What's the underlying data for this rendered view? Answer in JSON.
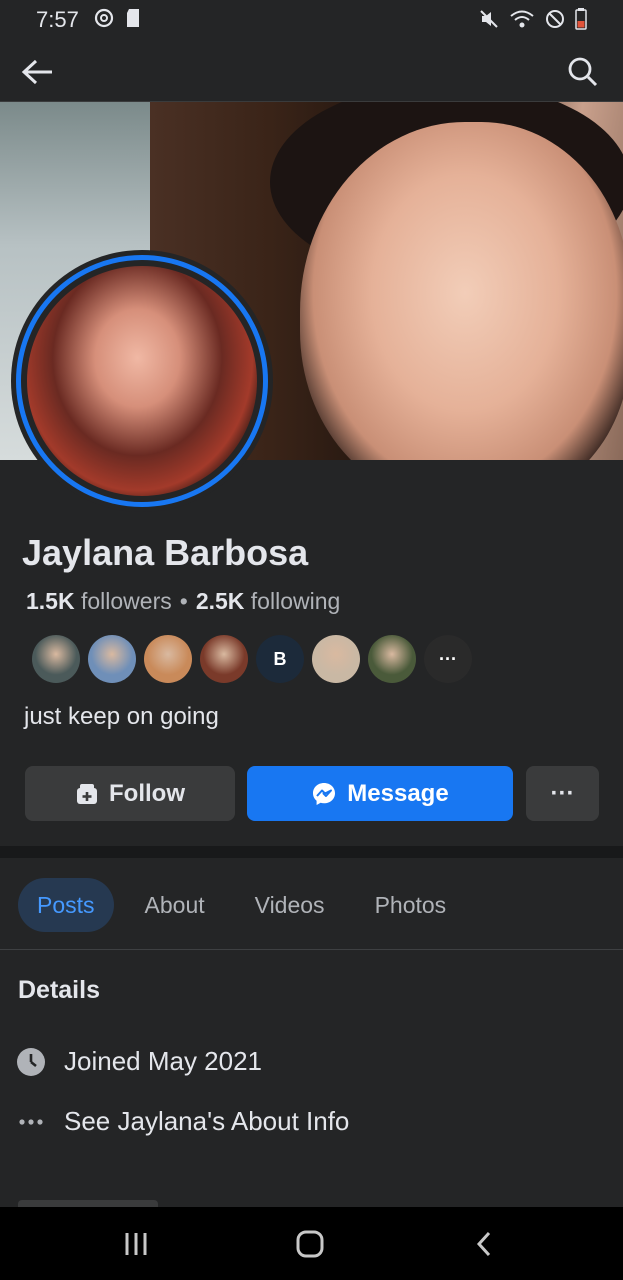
{
  "status_bar": {
    "time": "7:57",
    "left_icons": [
      "at-sign-icon",
      "sd-card-icon"
    ],
    "right_icons": [
      "mute-icon",
      "wifi-icon",
      "do-not-disturb-icon",
      "battery-low-icon"
    ]
  },
  "nav": {
    "back_icon": "back-arrow-icon",
    "search_icon": "search-icon"
  },
  "profile": {
    "name": "Jaylana Barbosa",
    "followers_count": "1.5K",
    "followers_label": "followers",
    "separator": "•",
    "following_count": "2.5K",
    "following_label": "following",
    "bio": "just keep on going",
    "mutual_friends": [
      {
        "color": "#4b5a5a"
      },
      {
        "color": "#6f8fb8"
      },
      {
        "color": "#c98a5a"
      },
      {
        "color": "#7a3a2a"
      },
      {
        "color": "#1c2a3a",
        "text": "B"
      },
      {
        "color": "#c9b8a4"
      },
      {
        "color": "#4a5a3a"
      },
      {
        "color": "#2a2a2a",
        "text": "···"
      }
    ]
  },
  "actions": {
    "follow_label": "Follow",
    "message_label": "Message",
    "more_label": "···"
  },
  "tabs": [
    {
      "label": "Posts",
      "active": true
    },
    {
      "label": "About",
      "active": false
    },
    {
      "label": "Videos",
      "active": false
    },
    {
      "label": "Photos",
      "active": false
    }
  ],
  "details": {
    "title": "Details",
    "joined": "Joined May 2021",
    "about_info": "See Jaylana's About Info"
  },
  "colors": {
    "background": "#242526",
    "accent": "#1877f2",
    "active_tab_text": "#4599ff",
    "active_tab_bg": "#263951"
  }
}
